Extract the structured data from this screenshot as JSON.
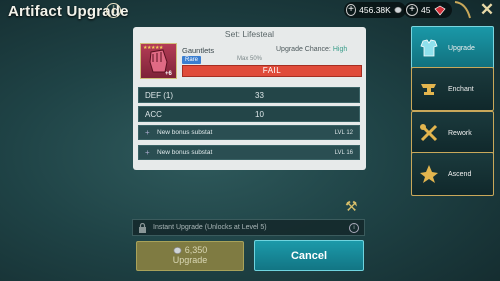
{
  "header": {
    "title": "Artifact Upgrade",
    "info_label": "i",
    "silver": "456.38K",
    "gems": "45",
    "close_label": "✕"
  },
  "panel": {
    "set_title": "Set: Lifesteal",
    "item_name": "Gauntlets",
    "rarity": "Rare",
    "item_level": "+6",
    "chance_label": "Upgrade Chance:",
    "chance_value": "High",
    "max_text": "Max 50%",
    "result": "FAIL",
    "stats": [
      {
        "key": "DEF (1)",
        "value": "33"
      },
      {
        "key": "ACC",
        "value": "10"
      }
    ],
    "substats": [
      {
        "text": "New bonus substat",
        "level": "LVL 12"
      },
      {
        "text": "New bonus substat",
        "level": "LVL 16"
      }
    ]
  },
  "instant": {
    "label": "Instant Upgrade (Unlocks at Level 5)"
  },
  "buttons": {
    "upgrade_cost": "6,350",
    "upgrade_label": "Upgrade",
    "cancel_label": "Cancel"
  },
  "tabs": [
    {
      "label": "Upgrade",
      "icon": "armor-icon",
      "active": true
    },
    {
      "label": "Enchant",
      "icon": "anvil-icon",
      "active": false
    },
    {
      "label": "Rework",
      "icon": "tools-icon",
      "active": false
    },
    {
      "label": "Ascend",
      "icon": "ascend-emblem-icon",
      "active": false
    }
  ],
  "colors": {
    "accent": "#1a98a8",
    "fail": "#e04b3a",
    "gold_border": "#c9a85a",
    "rare": "#3a7ed0"
  }
}
